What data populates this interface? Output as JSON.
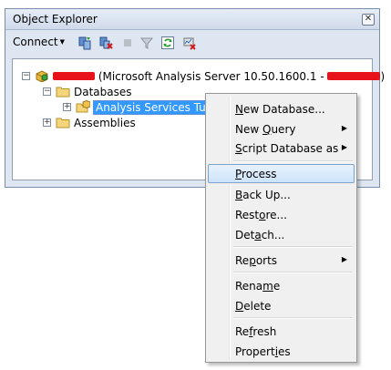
{
  "window": {
    "title": "Object Explorer",
    "close_glyph": "✕"
  },
  "toolbar": {
    "connect_label": "Connect",
    "icons": [
      "connect-server-icon",
      "disconnect-icon",
      "stop-icon",
      "filter-icon",
      "refresh-icon",
      "activity-icon"
    ]
  },
  "tree": {
    "server": {
      "label": " (Microsoft Analysis Server 10.50.1600.1 - ",
      "suffix": ")",
      "icon": "analysis-server-icon"
    },
    "databases_label": "Databases",
    "database_label": "Analysis Services Tutorial",
    "assemblies_label": "Assemblies"
  },
  "context_menu": {
    "items": [
      {
        "before": "",
        "key": "N",
        "after": "ew Database..."
      },
      {
        "before": "New ",
        "key": "Q",
        "after": "uery"
      },
      {
        "before": "",
        "key": "S",
        "after": "cript Database as"
      },
      {
        "before": "",
        "key": "P",
        "after": "rocess"
      },
      {
        "before": "",
        "key": "B",
        "after": "ack Up..."
      },
      {
        "before": "Rest",
        "key": "o",
        "after": "re..."
      },
      {
        "before": "Det",
        "key": "a",
        "after": "ch..."
      },
      {
        "before": "Re",
        "key": "p",
        "after": "orts"
      },
      {
        "before": "Rena",
        "key": "m",
        "after": "e"
      },
      {
        "before": "",
        "key": "D",
        "after": "elete"
      },
      {
        "before": "Re",
        "key": "f",
        "after": "resh"
      },
      {
        "before": "Propert",
        "key": "i",
        "after": "es"
      }
    ],
    "submenu_glyph": "▶"
  },
  "colors": {
    "selection": "#3399ff",
    "highlight_border": "#7da2ce",
    "redaction": "#e8121a"
  }
}
